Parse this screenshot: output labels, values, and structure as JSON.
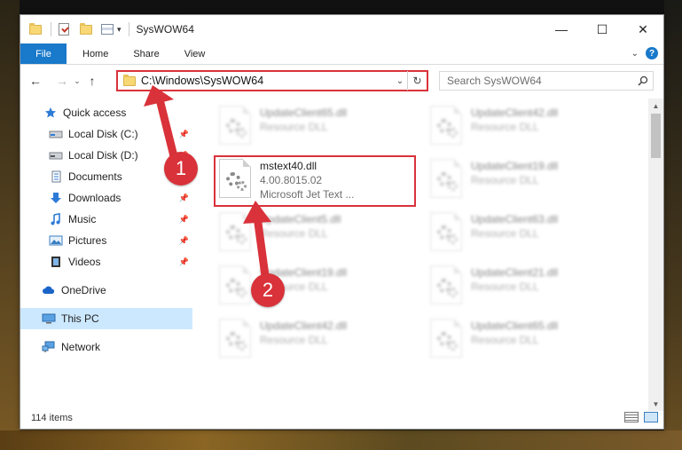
{
  "window": {
    "title": "SysWOW64",
    "minimize": "—",
    "maximize": "☐",
    "close": "✕"
  },
  "ribbon": {
    "tabs": [
      "File",
      "Home",
      "Share",
      "View"
    ],
    "help": "?"
  },
  "nav": {
    "back": "←",
    "forward": "→",
    "recent": "⌄",
    "up": "↑",
    "address": "C:\\Windows\\SysWOW64",
    "refresh": "↻",
    "search_placeholder": "Search SysWOW64"
  },
  "sidebar": {
    "items": [
      {
        "label": "Quick access",
        "icon": "star-icon"
      },
      {
        "label": "Local Disk (C:)",
        "icon": "drive-icon",
        "pinned": true
      },
      {
        "label": "Local Disk (D:)",
        "icon": "drive-icon",
        "pinned": true
      },
      {
        "label": "Documents",
        "icon": "documents-icon",
        "pinned": true
      },
      {
        "label": "Downloads",
        "icon": "download-icon",
        "pinned": true
      },
      {
        "label": "Music",
        "icon": "music-icon",
        "pinned": true
      },
      {
        "label": "Pictures",
        "icon": "pictures-icon",
        "pinned": true
      },
      {
        "label": "Videos",
        "icon": "video-icon",
        "pinned": true
      },
      {
        "label": "OneDrive",
        "icon": "cloud-icon"
      },
      {
        "label": "This PC",
        "icon": "computer-icon",
        "selected": true
      },
      {
        "label": "Network",
        "icon": "network-icon"
      }
    ]
  },
  "files": [
    {
      "name": "UpdateClient65.dll",
      "line2": "Resource DLL",
      "blur": true
    },
    {
      "name": "UpdateClient42.dll",
      "line2": "Resource DLL",
      "blur": true
    },
    {
      "name": "mstext40.dll",
      "line2": "4.00.8015.02",
      "line3": "Microsoft Jet Text ...",
      "blur": false
    },
    {
      "name": "UpdateClient19.dll",
      "line2": "Resource DLL",
      "blur": true
    },
    {
      "name": "UpdateClient5.dll",
      "line2": "Resource DLL",
      "blur": true
    },
    {
      "name": "UpdateClient63.dll",
      "line2": "Resource DLL",
      "blur": true
    },
    {
      "name": "UpdateClient19.dll",
      "line2": "Resource DLL",
      "blur": true
    },
    {
      "name": "UpdateClient21.dll",
      "line2": "Resource DLL",
      "blur": true
    },
    {
      "name": "UpdateClient42.dll",
      "line2": "Resource DLL",
      "blur": true
    },
    {
      "name": "UpdateClient65.dll",
      "line2": "Resource DLL",
      "blur": true
    }
  ],
  "status": {
    "item_count": "114 items"
  },
  "annotations": {
    "step1": "1",
    "step2": "2",
    "color": "#d9323a"
  }
}
